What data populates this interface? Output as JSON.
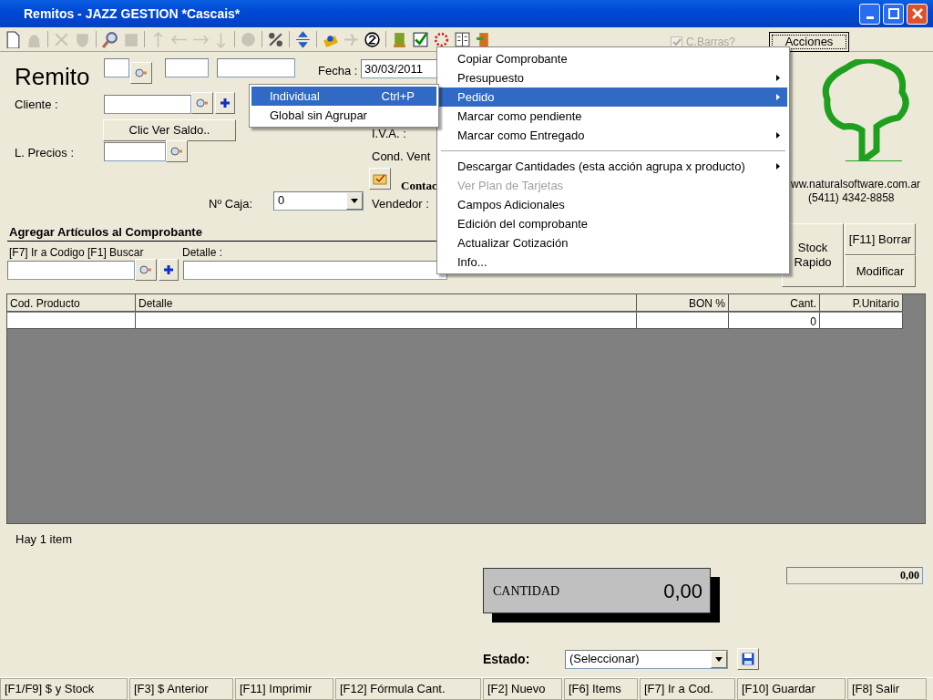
{
  "window": {
    "title": "Remitos - JAZZ GESTION *Cascais*"
  },
  "toolbar": [
    {
      "kind": "page",
      "disabled": false
    },
    {
      "kind": "bag",
      "disabled": true
    },
    {
      "kind": "sep"
    },
    {
      "kind": "cross",
      "disabled": true
    },
    {
      "kind": "shield",
      "disabled": true
    },
    {
      "kind": "sep"
    },
    {
      "kind": "search",
      "disabled": false
    },
    {
      "kind": "square",
      "disabled": true
    },
    {
      "kind": "sep"
    },
    {
      "kind": "up",
      "disabled": true
    },
    {
      "kind": "left",
      "disabled": true
    },
    {
      "kind": "right",
      "disabled": true
    },
    {
      "kind": "down",
      "disabled": true
    },
    {
      "kind": "sep"
    },
    {
      "kind": "circle",
      "disabled": true
    },
    {
      "kind": "sep"
    },
    {
      "kind": "percent",
      "disabled": false
    },
    {
      "kind": "sep"
    },
    {
      "kind": "updown",
      "disabled": false
    },
    {
      "kind": "sep"
    },
    {
      "kind": "card",
      "disabled": false
    },
    {
      "kind": "plane",
      "disabled": true
    },
    {
      "kind": "two",
      "disabled": false
    },
    {
      "kind": "sep"
    },
    {
      "kind": "book",
      "disabled": false
    },
    {
      "kind": "check",
      "disabled": false
    },
    {
      "kind": "ring",
      "disabled": false
    },
    {
      "kind": "columns",
      "disabled": false
    },
    {
      "kind": "door",
      "disabled": false
    }
  ],
  "barcode_checkbox": {
    "label": "C.Barras?",
    "checked": true,
    "disabled": true
  },
  "acciones_button": "Acciones",
  "form": {
    "heading": "Remito",
    "fecha_label": "Fecha :",
    "fecha": "30/03/2011",
    "cliente_label": "Cliente :",
    "saldo_button": "Clic Ver Saldo..",
    "precios_label": "L. Precios :",
    "iva_label": "I.V.A. :",
    "cond_venta_label": "Cond. Vent",
    "contact_label": "Contac",
    "caja_label": "Nº Caja:",
    "caja": "0",
    "vendedor_label": "Vendedor :"
  },
  "logo": {
    "url": "ww.naturalsoftware.com.ar",
    "phone": "(5411) 4342-8858"
  },
  "articulos": {
    "title": "Agregar Artículos al Comprobante",
    "code_label": "[F7] Ir a Codigo [F1] Buscar",
    "detalle_label": "Detalle :"
  },
  "side_buttons": [
    "Stock Rapido",
    "[F11] Borrar",
    "Modificar"
  ],
  "table": {
    "columns": [
      "Cod. Producto",
      "Detalle",
      "BON %",
      "Cant.",
      "P.Unitario"
    ],
    "rows": [
      [
        "",
        "",
        "",
        "0",
        ""
      ]
    ]
  },
  "item_count": "Hay 1 item",
  "total": "0,00",
  "cantidad": {
    "label": "CANTIDAD",
    "value": "0,00"
  },
  "estado": {
    "label": "Estado:",
    "value": "(Seleccionar)"
  },
  "function_keys": [
    "[F1/F9] $ y Stock",
    "[F3] $ Anterior",
    "[F11] Imprimir",
    "[F12] Fórmula Cant.",
    "[F2] Nuevo",
    "[F6] Items",
    "[F7] Ir a Cod.",
    "[F10] Guardar",
    "[F8] Salir"
  ],
  "menu": [
    {
      "kind": "item",
      "label": "Copiar Comprobante",
      "submenu": false,
      "selected": false,
      "disabled": false
    },
    {
      "kind": "item",
      "label": "Presupuesto",
      "submenu": true,
      "selected": false,
      "disabled": false
    },
    {
      "kind": "item",
      "label": "Pedido",
      "submenu": true,
      "selected": true,
      "disabled": false
    },
    {
      "kind": "item",
      "label": "Marcar como pendiente",
      "submenu": false,
      "selected": false,
      "disabled": false
    },
    {
      "kind": "item",
      "label": "Marcar como Entregado",
      "submenu": true,
      "selected": false,
      "disabled": false
    },
    {
      "kind": "separator"
    },
    {
      "kind": "item",
      "label": "Descargar Cantidades (esta acción agrupa x producto)",
      "submenu": true,
      "selected": false,
      "disabled": false
    },
    {
      "kind": "item",
      "label": "Ver Plan de Tarjetas",
      "submenu": false,
      "selected": false,
      "disabled": true
    },
    {
      "kind": "item",
      "label": "Campos Adicionales",
      "submenu": false,
      "selected": false,
      "disabled": false
    },
    {
      "kind": "item",
      "label": "Edición del comprobante",
      "submenu": false,
      "selected": false,
      "disabled": false
    },
    {
      "kind": "item",
      "label": "Actualizar Cotización",
      "submenu": false,
      "selected": false,
      "disabled": false
    },
    {
      "kind": "item",
      "label": "Info...",
      "submenu": false,
      "selected": false,
      "disabled": false
    }
  ],
  "submenu": [
    {
      "label": "Individual",
      "shortcut": "Ctrl+P",
      "selected": true
    },
    {
      "label": "Global sin Agrupar",
      "selected": false
    }
  ]
}
